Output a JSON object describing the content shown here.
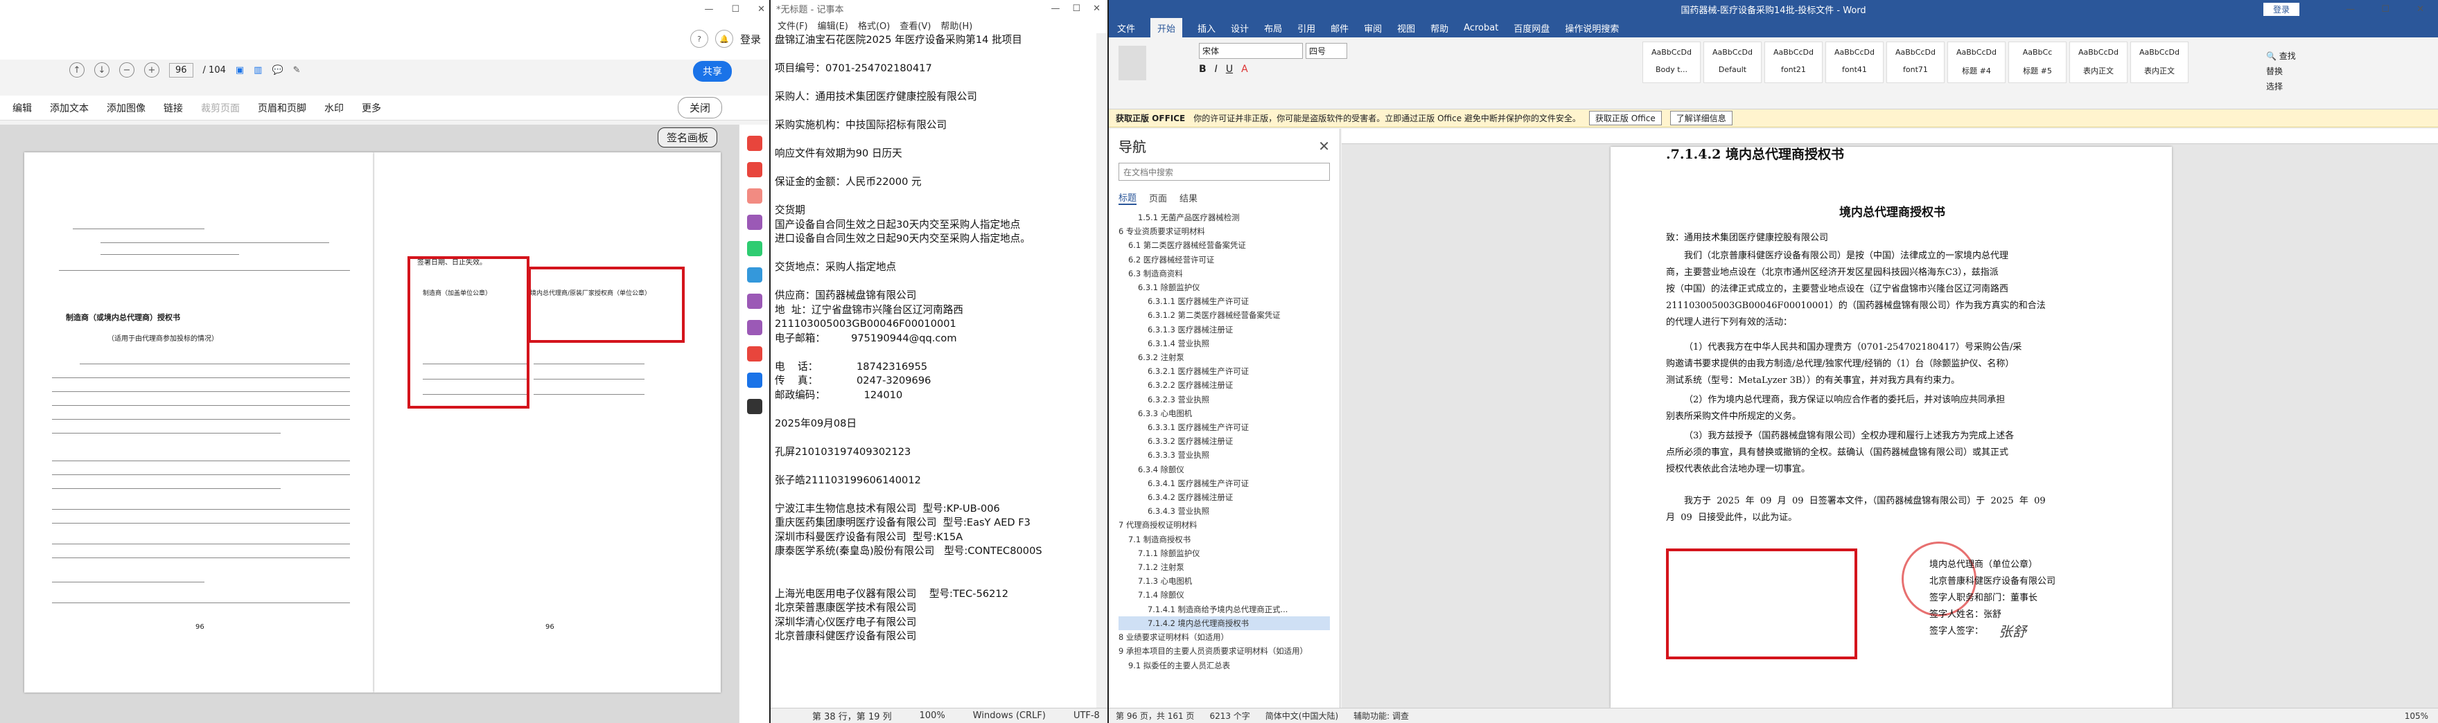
{
  "pdf": {
    "toolbar1": {
      "page_current": "96",
      "page_total": "/ 104",
      "share": "共享",
      "login": "登录"
    },
    "toolbar2": [
      "编辑",
      "添加文本",
      "添加图像",
      "链接",
      "裁剪页面",
      "页眉和页脚",
      "水印",
      "更多"
    ],
    "close": "关闭",
    "signature_pad": "签名画板",
    "page_left_title1": "制造商（或境内总代理商）授权书",
    "page_left_title2": "（适用于由代理商参加投标的情况）",
    "page_right_line1": "签署日期、日止失效。",
    "page_right_box1": "制造商（加盖单位公章）",
    "page_right_box2": "境内总代理商/原装厂家授权商（单位公章）",
    "page_num_left": "96",
    "page_num_right": "96"
  },
  "notepad": {
    "title": "*无标题 - 记事本",
    "menu": [
      "文件(F)",
      "编辑(E)",
      "格式(O)",
      "查看(V)",
      "帮助(H)"
    ],
    "lines": [
      "盘锦辽油宝石花医院2025 年医疗设备采购第14 批项目",
      "",
      "项目编号：0701-254702180417",
      "",
      "采购人：通用技术集团医疗健康控股有限公司",
      "",
      "采购实施机构：中技国际招标有限公司",
      "",
      "响应文件有效期为90 日历天",
      "",
      "保证金的金额：人民币22000 元",
      "",
      "交货期",
      "国产设备自合同生效之日起30天内交至采购人指定地点",
      "进口设备自合同生效之日起90天内交至采购人指定地点。",
      "",
      "交货地点：采购人指定地点",
      "",
      "供应商：国药器械盘锦有限公司",
      "地  址：辽宁省盘锦市兴隆台区辽河南路西",
      "211103005003GB00046F00010001",
      "电子邮箱：        975190944@qq.com",
      "",
      "电    话：            18742316955",
      "传    真：            0247-3209696",
      "邮政编码：            124010",
      "",
      "2025年09月08日",
      "",
      "孔屏210103197409302123",
      "",
      "张子皓211103199606140012",
      "",
      "宁波江丰生物信息技术有限公司  型号:KP-UB-006",
      "重庆医药集团康明医疗设备有限公司  型号:EasY AED F3",
      "深圳市科曼医疗设备有限公司  型号:K15A",
      "康泰医学系统(秦皇岛)股份有限公司   型号:CONTEC8000S",
      "",
      "",
      "上海光电医用电子仪器有限公司    型号:TEC-56212",
      "北京荣普惠康医学技术有限公司",
      "深圳华清心仪医疗电子有限公司",
      "北京普康科健医疗设备有限公司"
    ],
    "status": {
      "pos": "第 38 行，第 19 列",
      "zoom": "100%",
      "eol": "Windows (CRLF)",
      "enc": "UTF-8"
    }
  },
  "word": {
    "title": "国药器械-医疗设备采购14批-投标文件 - Word",
    "login": "登录",
    "tabs": [
      "文件",
      "开始",
      "插入",
      "设计",
      "布局",
      "引用",
      "邮件",
      "审阅",
      "视图",
      "帮助",
      "Acrobat",
      "百度网盘",
      "操作说明搜索"
    ],
    "font_name": "宋体",
    "font_size": "四号",
    "styles": [
      "AaBbCcDd",
      "AaBbCcDd",
      "AaBbCcDd",
      "AaBbCcDd",
      "AaBbCcDd",
      "AaBbCcDd",
      "AaBbCc",
      "AaBbCcDd",
      "AaBbCcDd"
    ],
    "style_names": [
      "Body t...",
      "Default",
      "font21",
      "font41",
      "font71",
      "标题 #4",
      "标题 #5",
      "表内正文",
      "表内正文"
    ],
    "info_label": "获取正版 OFFICE",
    "info_text": "你的许可证并非正版，你可能是盗版软件的受害者。立即通过正版 Office 避免中断并保护你的文件安全。",
    "info_btn1": "获取正版 Office",
    "info_btn2": "了解详细信息",
    "nav": {
      "title": "导航",
      "search": "在文档中搜索",
      "tabs": [
        "标题",
        "页面",
        "结果"
      ],
      "items": [
        "1.5.1 无菌产品医疗器械检测",
        "6 专业资质要求证明材料",
        "6.1 第二类医疗器械经营备案凭证",
        "6.2 医疗器械经营许可证",
        "6.3 制造商资料",
        "6.3.1 除颤监护仪",
        "6.3.1.1 医疗器械生产许可证",
        "6.3.1.2 第二类医疗器械经营备案凭证",
        "6.3.1.3 医疗器械注册证",
        "6.3.1.4 营业执照",
        "6.3.2 注射泵",
        "6.3.2.1 医疗器械生产许可证",
        "6.3.2.2 医疗器械注册证",
        "6.3.2.3 营业执照",
        "6.3.3 心电图机",
        "6.3.3.1 医疗器械生产许可证",
        "6.3.3.2 医疗器械注册证",
        "6.3.3.3 营业执照",
        "6.3.4 除颤仪",
        "6.3.4.1 医疗器械生产许可证",
        "6.3.4.2 医疗器械注册证",
        "6.3.4.3 营业执照",
        "7 代理商授权证明材料",
        "7.1 制造商授权书",
        "7.1.1 除颤监护仪",
        "7.1.2 注射泵",
        "7.1.3 心电图机",
        "7.1.4 除颤仪",
        "7.1.4.1 制造商给予境内总代理商正式...",
        "7.1.4.2 境内总代理商授权书",
        "8 业绩要求证明材料（如适用）",
        "9 承担本项目的主要人员资质要求证明材料（如适用）",
        "9.1 拟委任的主要人员汇总表"
      ]
    },
    "doc": {
      "heading": ".7.1.4.2 境内总代理商授权书",
      "title": "境内总代理商授权书",
      "to": "致：通用技术集团医疗健康控股有限公司",
      "p1": "我们（北京普康科健医疗设备有限公司）是按（中国）法律成立的一家境内总代理",
      "p2": "商，主要营业地点设在（北京市通州区经济开发区星园科技园兴格海东C3），兹指派",
      "p3": "按（中国）的法律正式成立的，主要营业地点设在（辽宁省盘锦市兴隆台区辽河南路西",
      "p4": "211103005003GB00046F00010001）的（国药器械盘锦有限公司）作为我方真实的和合法",
      "p5": "的代理人进行下列有效的活动：",
      "p6": "（1）代表我方在中华人民共和国办理贵方（0701-254702180417）号采购公告/采",
      "p7": "购邀请书要求提供的由我方制造/总代理/独家代理/经销的（1）台（除颤监护仪、名称）",
      "p8": "测试系统（型号：MetaLyzer 3B））的有关事宜，并对我方具有约束力。",
      "p9": "（2）作为境内总代理商，我方保证以响应合作者的委托后，并对该响应共同承担",
      "p10": "别表所采购文件中所规定的义务。",
      "p11": "（3）我方兹授予（国药器械盘锦有限公司）全权办理和履行上述我方为完成上述各",
      "p12": "点所必须的事宜，具有替换或撤销的全权。兹确认（国药器械盘锦有限公司）或其正式",
      "p13": "授权代表依此合法地办理一切事宜。",
      "p14": "我方于  2025  年  09  月  09  日签署本文件，（国药器械盘锦有限公司）于  2025  年  09",
      "p15": "月  09  日接受此件，以此为证。",
      "s1": "境内总代理商（单位公章）",
      "s2": "北京普康科健医疗设备有限公司",
      "s3": "签字人职务和部门：董事长",
      "s4": "签字人姓名：张舒",
      "s5": "签字人签字：",
      "signature": "张舒"
    },
    "status": {
      "page": "第 96 页，共 161 页",
      "words": "6213 个字",
      "lang": "简体中文(中国大陆)",
      "assist": "辅助功能: 调查",
      "zoom": "105%"
    }
  }
}
